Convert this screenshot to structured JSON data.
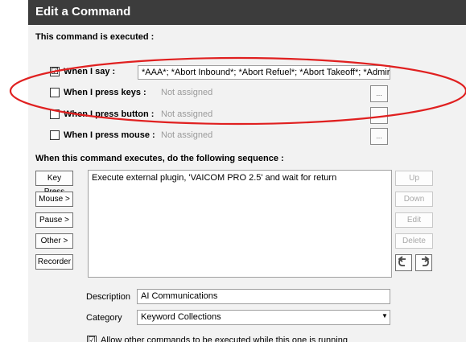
{
  "window": {
    "title": "Edit a Command"
  },
  "section_executed": "This command is executed :",
  "triggers": [
    {
      "label": "When I say :",
      "checked": "☑",
      "value": "*AAA*; *Abort Inbound*; *Abort Refuel*; *Abort Takeoff*; *Admira"
    },
    {
      "label": "When I press keys :",
      "checked": "",
      "value": "Not assigned",
      "button": "..."
    },
    {
      "label": "When I press button :",
      "checked": "",
      "value": "Not assigned",
      "button": "..."
    },
    {
      "label": "When I press mouse :",
      "checked": "",
      "value": "Not assigned",
      "button": "..."
    }
  ],
  "section_sequence": "When this command executes, do the following sequence :",
  "left_buttons": [
    "Key Press",
    "Mouse >",
    "Pause >",
    "Other >",
    "Recorder"
  ],
  "sequence_items": [
    "Execute external plugin, 'VAICOM PRO 2.5' and wait for return"
  ],
  "right_buttons": [
    "Up",
    "Down",
    "Edit",
    "Delete"
  ],
  "description": {
    "label": "Description",
    "value": "AI Communications"
  },
  "category": {
    "label": "Category",
    "value": "Keyword Collections"
  },
  "allow_option": {
    "label": "Allow other commands to be executed while this one is running",
    "checked": "☑"
  },
  "colors": {
    "title_bar": "#3c3c3c",
    "annotation": "#e02020"
  }
}
